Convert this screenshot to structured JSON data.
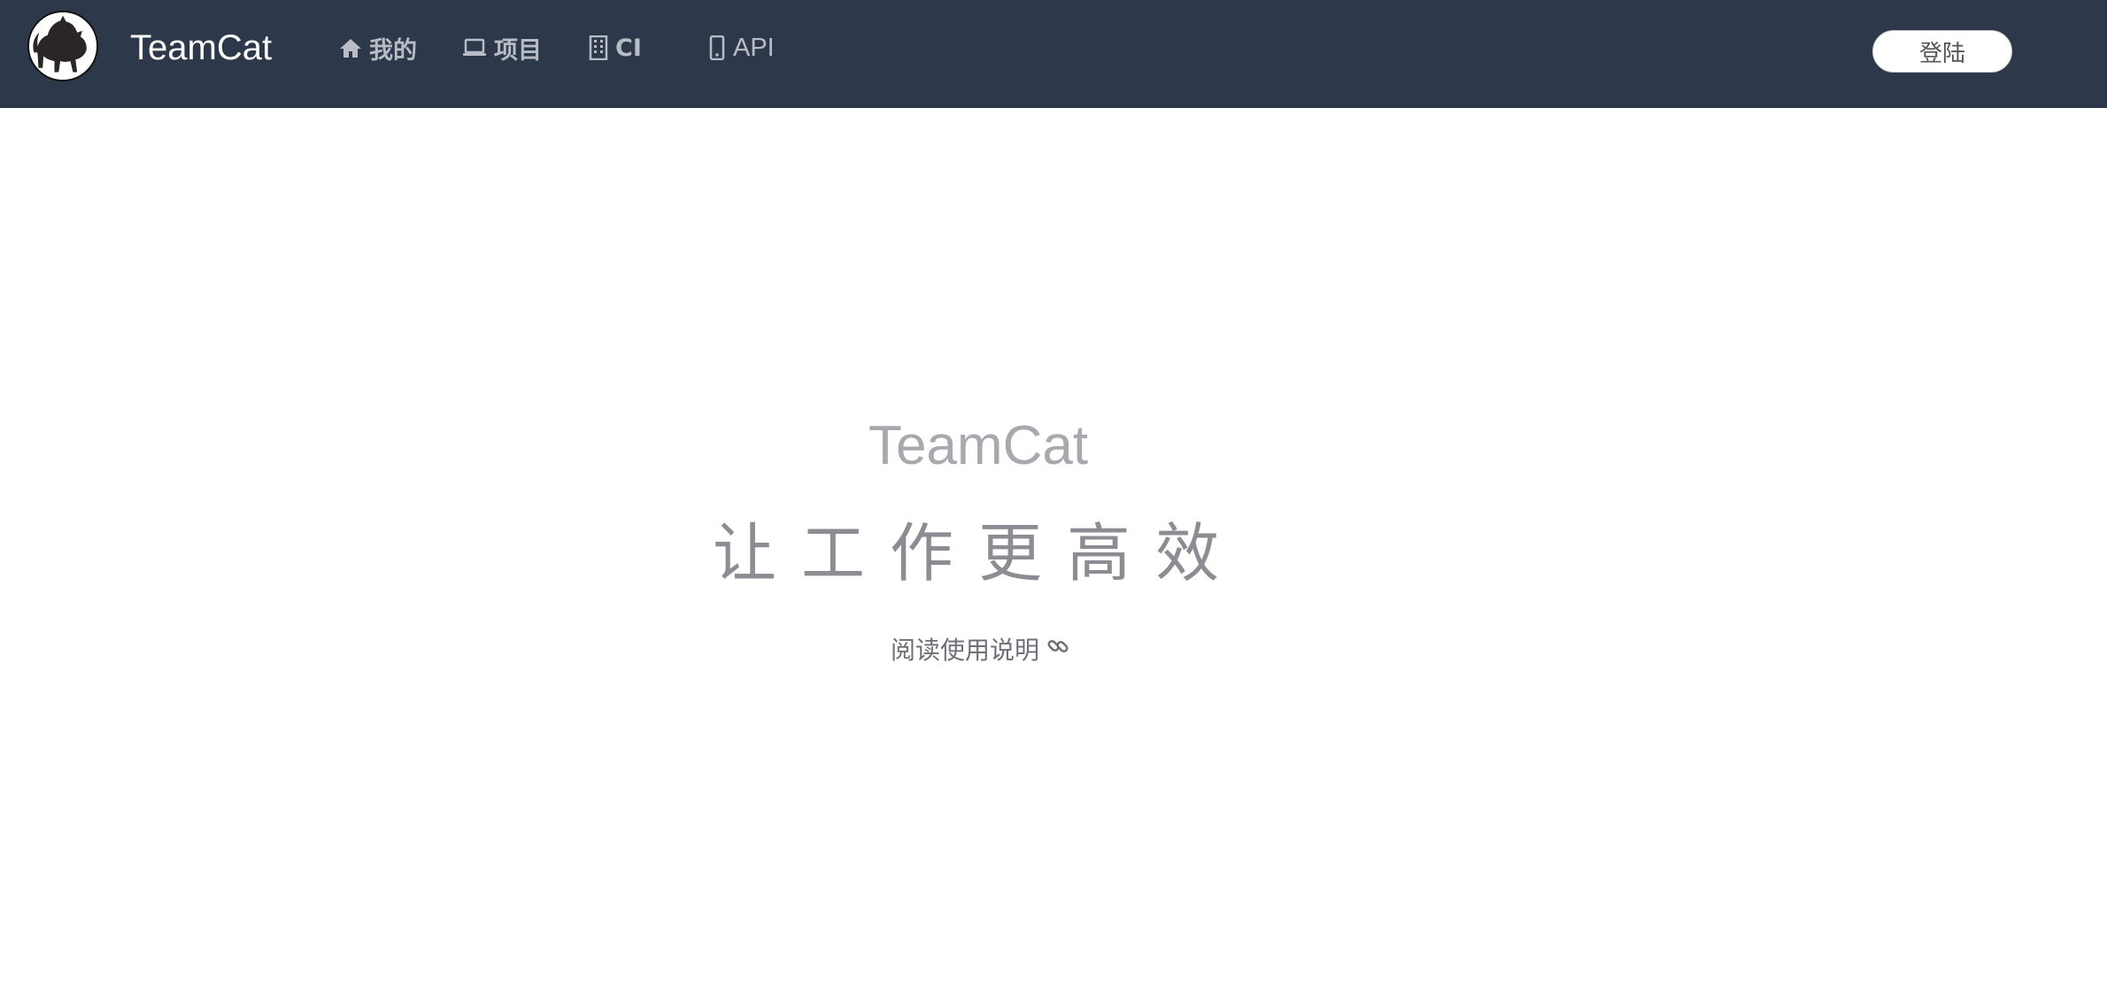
{
  "header": {
    "logo_icon": "cat-logo-icon",
    "brand": "TeamCat",
    "nav": [
      {
        "icon": "home-icon",
        "label": "我的"
      },
      {
        "icon": "laptop-icon",
        "label": "项目"
      },
      {
        "icon": "building-icon",
        "label": "CI"
      },
      {
        "icon": "mobile-icon",
        "label": "API"
      }
    ],
    "login_label": "登陆"
  },
  "hero": {
    "title": "TeamCat",
    "slogan": "让工作更高效",
    "link_label": "阅读使用说明",
    "link_icon": "chain-link-icon"
  },
  "colors": {
    "topbar": "#2d384a",
    "nav_text": "#b7bcc5",
    "hero_title": "#a7a9ae",
    "hero_slogan": "#8b8d93"
  }
}
